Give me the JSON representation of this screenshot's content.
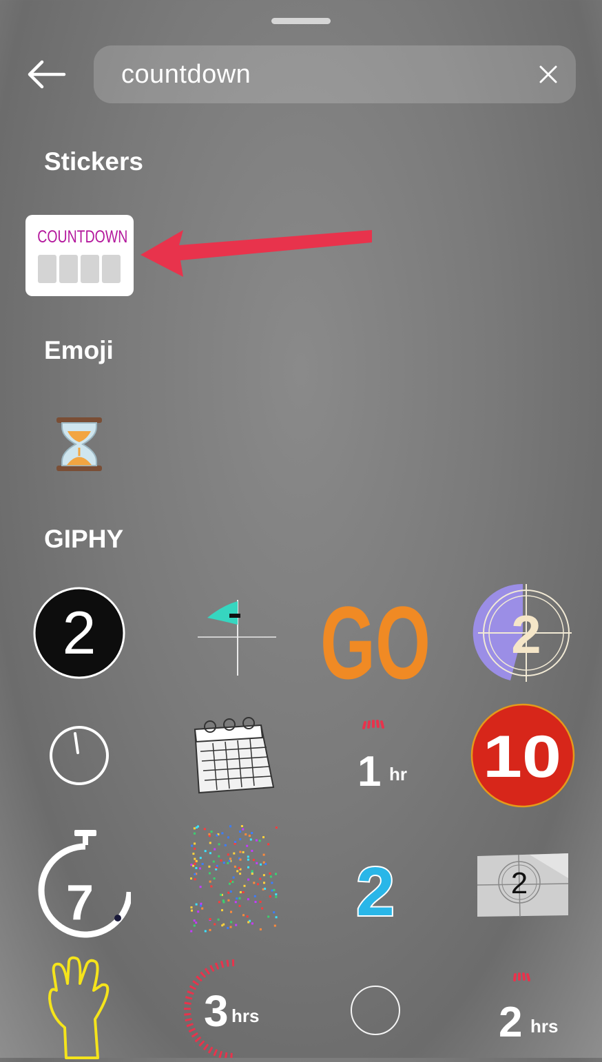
{
  "search": {
    "query": "countdown"
  },
  "sections": {
    "stickers": "Stickers",
    "emoji": "Emoji",
    "giphy": "GIPHY"
  },
  "countdown_sticker": {
    "label": "COUNTDOWN"
  },
  "emoji_items": [
    {
      "icon": "hourglass-icon"
    }
  ],
  "giphy_items": [
    {
      "icon": "number-2-black-circle-icon",
      "text": "2"
    },
    {
      "icon": "sprouting-plant-icon"
    },
    {
      "icon": "go-text-icon",
      "text": "GO"
    },
    {
      "icon": "film-leader-2-icon",
      "text": "2"
    },
    {
      "icon": "clock-icon"
    },
    {
      "icon": "calendar-icon"
    },
    {
      "icon": "one-hour-icon",
      "num": "1",
      "unit": "hr"
    },
    {
      "icon": "number-10-red-icon",
      "text": "10"
    },
    {
      "icon": "stopwatch-7-icon",
      "text": "7"
    },
    {
      "icon": "confetti-icon"
    },
    {
      "icon": "number-2-blue-icon",
      "text": "2"
    },
    {
      "icon": "film-leader-2-gray-icon",
      "text": "2"
    },
    {
      "icon": "three-fingers-hand-icon"
    },
    {
      "icon": "three-hours-icon",
      "num": "3",
      "unit": "hrs"
    },
    {
      "icon": "circle-outline-icon"
    },
    {
      "icon": "two-hours-icon",
      "num": "2",
      "unit": "hrs"
    }
  ],
  "colors": {
    "countdown_text": "#b3179c",
    "arrow": "#e8334c",
    "go_orange": "#f08a24",
    "ten_red": "#d7261a",
    "blue_two": "#29b6e8",
    "purple": "#9b8ee6"
  }
}
